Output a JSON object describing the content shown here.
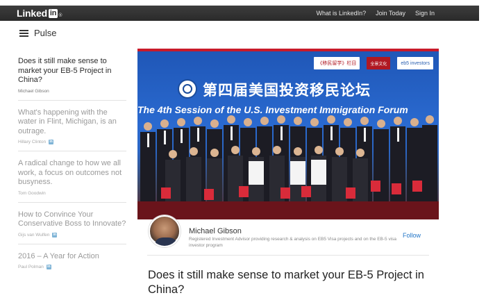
{
  "header": {
    "logo_text": "Linked",
    "logo_in": "in",
    "logo_dot": "®",
    "nav": [
      "What is LinkedIn?",
      "Join Today",
      "Sign In"
    ]
  },
  "pulse": {
    "label": "Pulse",
    "menu_icon": "hamburger-menu-icon"
  },
  "sidebar": {
    "items": [
      {
        "title": "Does it still make sense to market your EB-5 Project in China?",
        "author": "Michael Gibson",
        "linkedin_badge": false,
        "active": true
      },
      {
        "title": "What's happening with the water in Flint, Michigan, is an outrage.",
        "author": "Hillary Clinton",
        "linkedin_badge": true,
        "active": false
      },
      {
        "title": "A radical change to how we all work, a focus on outcomes not busyness.",
        "author": "Tom Goodwin",
        "linkedin_badge": false,
        "active": false
      },
      {
        "title": "How to Convince Your Conservative Boss to Innovate?",
        "author": "Gijs van Wulfen",
        "linkedin_badge": true,
        "active": false
      },
      {
        "title": "2016 – A Year for Action",
        "author": "Paul Polman",
        "linkedin_badge": true,
        "active": false
      }
    ],
    "badge_text": "in"
  },
  "hero": {
    "title_cn": "第四届美国投资移民论坛",
    "title_en": "The 4th Session of the U.S. Investment Immigration Forum",
    "logos": [
      "《移民留学》栏目",
      "全景文化",
      "eb5 investors"
    ],
    "colors": {
      "sky": "#2a6ad0",
      "stripe": "#c91a2a",
      "floor": "#5a0f15"
    }
  },
  "author": {
    "name": "Michael Gibson",
    "description": "Registered Investment Advisor providing research & analysis on EB5 Visa projects and on the EB-5 visa investor program",
    "follow_label": "Follow"
  },
  "article": {
    "title": "Does it still make sense to market your EB-5 Project in China?"
  }
}
